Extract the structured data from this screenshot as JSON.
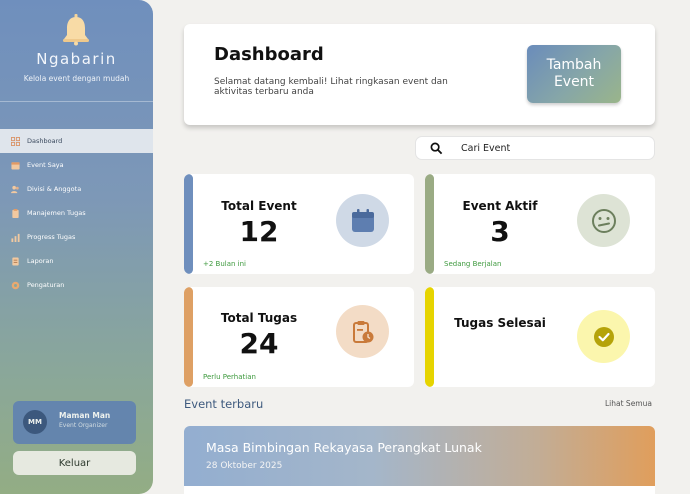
{
  "sidebar": {
    "brand": "Ngabarin",
    "tagline": "Kelola event dengan mudah",
    "items": [
      {
        "label": "Dashboard",
        "icon": "grid-icon",
        "active": true
      },
      {
        "label": "Event Saya",
        "icon": "calendar-icon",
        "active": false
      },
      {
        "label": "Divisi & Anggota",
        "icon": "users-icon",
        "active": false
      },
      {
        "label": "Manajemen Tugas",
        "icon": "clipboard-icon",
        "active": false
      },
      {
        "label": "Progress Tugas",
        "icon": "bar-chart-icon",
        "active": false
      },
      {
        "label": "Laporan",
        "icon": "document-icon",
        "active": false
      },
      {
        "label": "Pengaturan",
        "icon": "gear-icon",
        "active": false
      }
    ],
    "user": {
      "initials": "MM",
      "name": "Maman Man",
      "role": "Event Organizer"
    },
    "logout_label": "Keluar"
  },
  "header": {
    "title": "Dashboard",
    "welcome": "Selamat datang kembali! Lihat ringkasan event dan aktivitas terbaru anda",
    "add_button": "Tambah Event"
  },
  "search": {
    "placeholder": "Cari Event"
  },
  "stats": [
    {
      "label": "Total Event",
      "value": "12",
      "note": "+2 Bulan ini",
      "icon": "calendar-icon"
    },
    {
      "label": "Event Aktif",
      "value": "3",
      "note": "Sedang Berjalan",
      "icon": "confused-face-icon"
    },
    {
      "label": "Total Tugas",
      "value": "24",
      "note": "Perlu Perhatian",
      "icon": "clipboard-clock-icon"
    },
    {
      "label": "Tugas Selesai",
      "value": "",
      "note": "",
      "icon": "check-circle-icon"
    }
  ],
  "recent": {
    "title": "Event terbaru",
    "see_all": "Lihat Semua",
    "events": [
      {
        "name": "Masa Bimbingan Rekayasa Perangkat Lunak",
        "date": "28 Oktober 2025"
      }
    ]
  },
  "colors": {
    "blue_accent": "#6f8fbd",
    "green_accent": "#9aab84",
    "orange_accent": "#dea064",
    "yellow_accent": "#e6d400",
    "note_green": "#3f9a3f"
  }
}
